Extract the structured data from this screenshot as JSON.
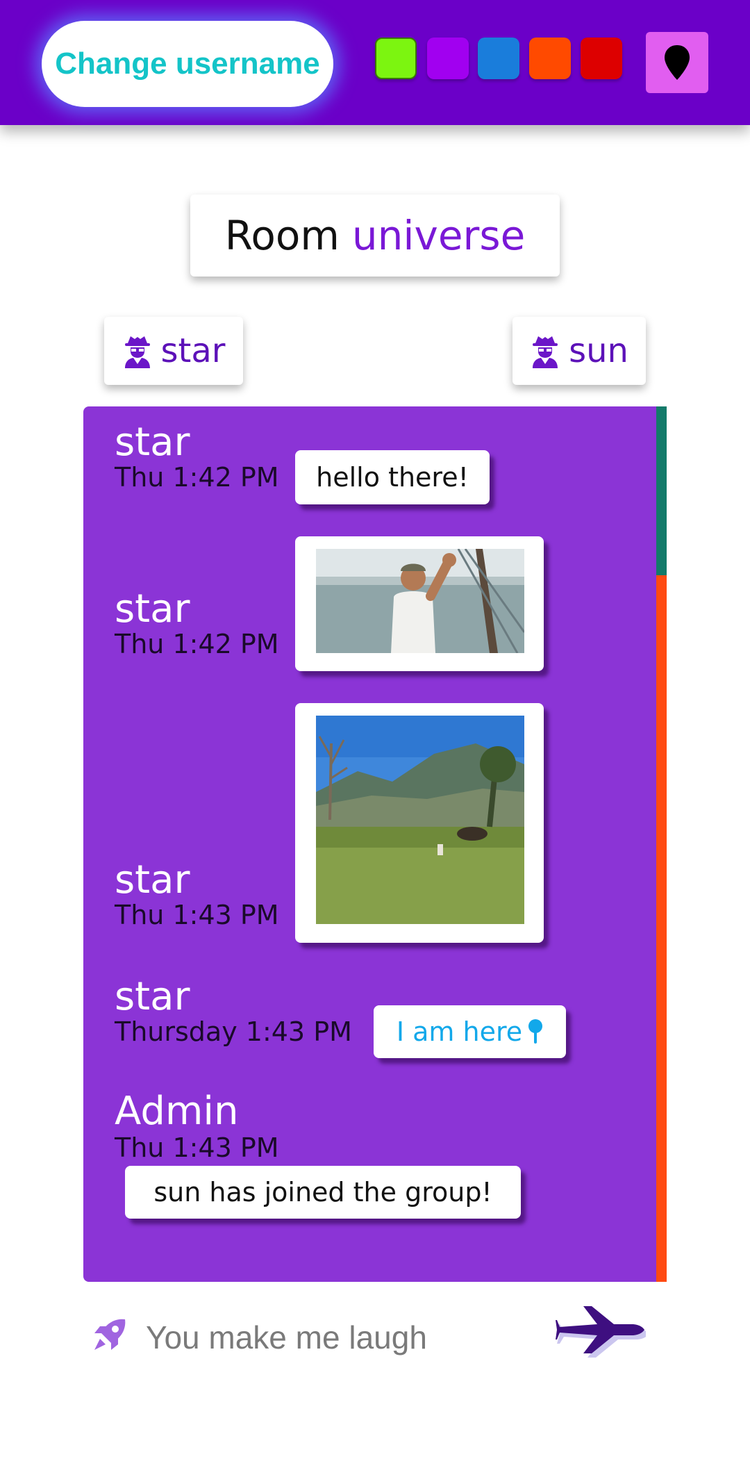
{
  "header": {
    "change_username": "Change username",
    "color_swatches": [
      {
        "name": "green",
        "color": "#7cf510"
      },
      {
        "name": "purple",
        "color": "#a100f0"
      },
      {
        "name": "blue",
        "color": "#1a7ddb"
      },
      {
        "name": "orange",
        "color": "#ff4a00"
      },
      {
        "name": "red",
        "color": "#dd0000"
      }
    ],
    "location_icon": "map-pin-icon"
  },
  "room": {
    "prefix": "Room",
    "name": "universe"
  },
  "users": [
    {
      "name": "star",
      "icon": "user-secret-icon"
    },
    {
      "name": "sun",
      "icon": "user-secret-icon"
    }
  ],
  "messages": [
    {
      "author": "star",
      "time": "Thu 1:42 PM",
      "text": "hello there!"
    },
    {
      "author": "star",
      "time": "Thu 1:42 PM",
      "image": "waving-man-gif"
    },
    {
      "author": "star",
      "time": "Thu 1:43 PM",
      "image": "field-gif"
    },
    {
      "author": "star",
      "time": "Thursday 1:43 PM",
      "link": "I am here",
      "link_icon": "pin-icon"
    },
    {
      "author": "Admin",
      "time": "Thu 1:43 PM",
      "text": "sun has joined the group!"
    }
  ],
  "composer": {
    "value": "You make me laugh",
    "send_icon": "jet-plane-icon",
    "leading_icon": "rocket-icon"
  },
  "colors": {
    "header_bg": "#6b00c8",
    "chat_bg": "#8b34d6",
    "accent_cyan": "#14c4c8",
    "room_name": "#7a18d6",
    "location_button": "#e15ef0",
    "link": "#12a8ea"
  }
}
